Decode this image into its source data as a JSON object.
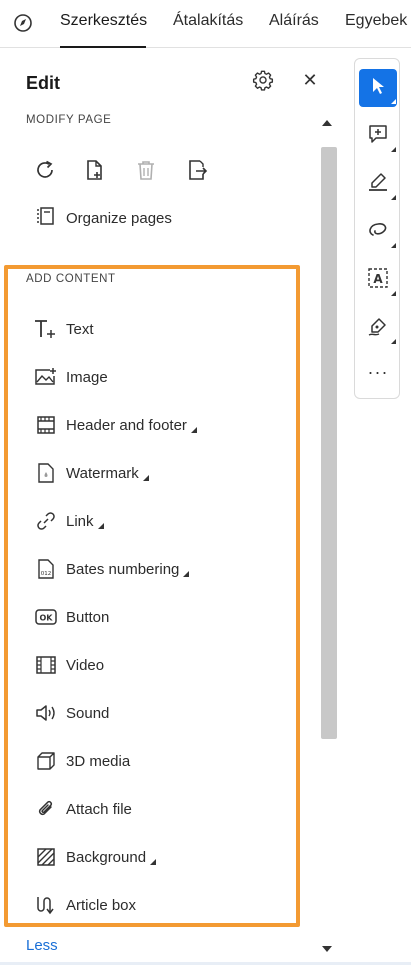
{
  "topbar": {
    "tabs": [
      {
        "label": "Szerkesztés"
      },
      {
        "label": "Átalakítás"
      },
      {
        "label": "Aláírás"
      },
      {
        "label": "Egyebek"
      }
    ]
  },
  "panel": {
    "title": "Edit",
    "modify_section": "MODIFY PAGE",
    "modify_icons": [
      "rotate-page-icon",
      "insert-page-icon",
      "delete-page-icon",
      "extract-page-icon"
    ],
    "organize_label": "Organize pages",
    "add_section": "ADD CONTENT",
    "items": [
      {
        "label": "Text",
        "icon": "text-icon",
        "submenu": false
      },
      {
        "label": "Image",
        "icon": "image-icon",
        "submenu": false
      },
      {
        "label": "Header and footer",
        "icon": "header-footer-icon",
        "submenu": true
      },
      {
        "label": "Watermark",
        "icon": "watermark-icon",
        "submenu": true
      },
      {
        "label": "Link",
        "icon": "link-icon",
        "submenu": true
      },
      {
        "label": "Bates numbering",
        "icon": "bates-icon",
        "submenu": true
      },
      {
        "label": "Button",
        "icon": "button-icon",
        "submenu": false
      },
      {
        "label": "Video",
        "icon": "video-icon",
        "submenu": false
      },
      {
        "label": "Sound",
        "icon": "sound-icon",
        "submenu": false
      },
      {
        "label": "3D media",
        "icon": "3d-media-icon",
        "submenu": false
      },
      {
        "label": "Attach file",
        "icon": "attach-icon",
        "submenu": false
      },
      {
        "label": "Background",
        "icon": "background-icon",
        "submenu": true
      },
      {
        "label": "Article box",
        "icon": "article-box-icon",
        "submenu": false
      }
    ],
    "less_label": "Less",
    "bates_icon_text": "012"
  },
  "rail": {
    "tools": [
      "select-cursor-icon",
      "add-comment-icon",
      "highlight-icon",
      "draw-freeform-icon",
      "text-box-icon",
      "sign-icon"
    ],
    "more_label": "···"
  },
  "colors": {
    "accent": "#1473e6",
    "highlight_border": "#f39a32",
    "link": "#1a6fd6"
  }
}
